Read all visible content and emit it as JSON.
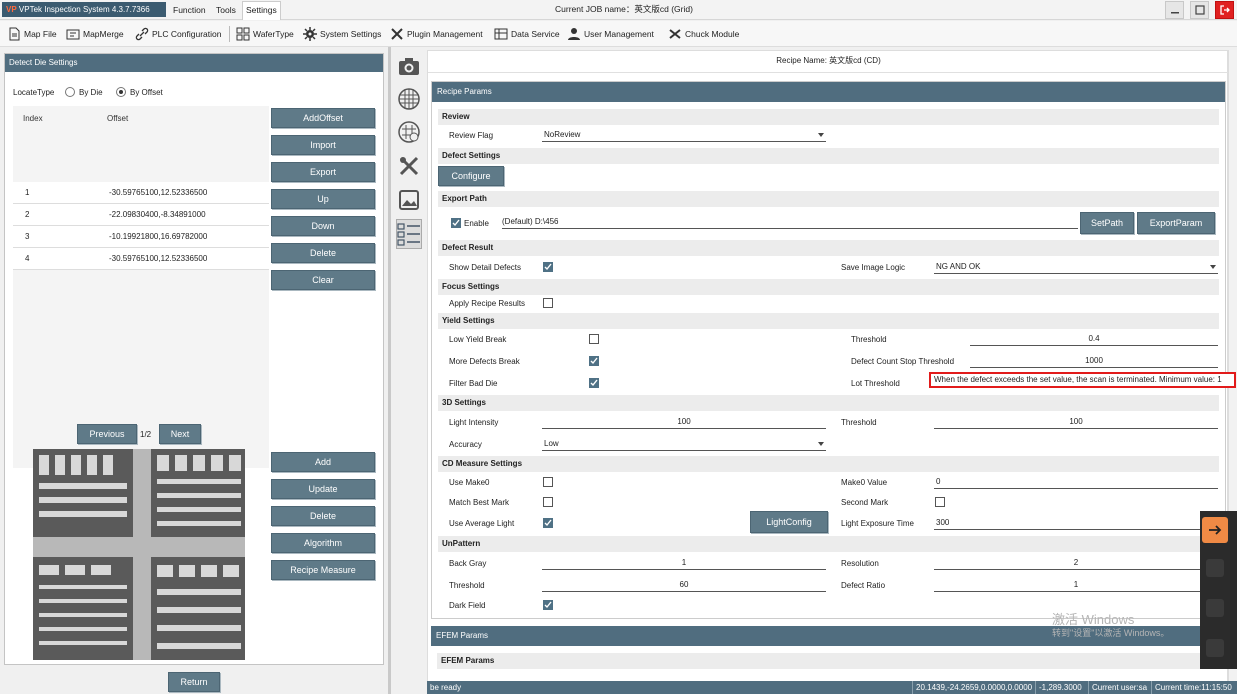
{
  "titlebar": {
    "app_name": "VPTek Inspection System 4.3.7.7366",
    "menus": [
      "Function",
      "Tools",
      "Settings"
    ],
    "job_name": "Current JOB name：英文版cd (Grid)"
  },
  "toolbar": {
    "items": [
      "Map File",
      "MapMerge",
      "PLC Configuration",
      "WaferType",
      "System Settings",
      "Plugin Management",
      "Data Service",
      "User Management",
      "Chuck Module"
    ]
  },
  "left_panel": {
    "title": "Detect Die Settings",
    "locate_type_label": "LocateType",
    "radio_by_die": "By Die",
    "radio_by_offset": "By Offset",
    "table_headers": [
      "Index",
      "Offset"
    ],
    "rows": [
      {
        "index": "1",
        "offset": "-30.59765100,12.52336500"
      },
      {
        "index": "2",
        "offset": "-22.09830400,-8.34891000"
      },
      {
        "index": "3",
        "offset": "-10.19921800,16.69782000"
      },
      {
        "index": "4",
        "offset": "-30.59765100,12.52336500"
      }
    ],
    "buttons_top": [
      "AddOffset",
      "Import",
      "Export",
      "Up",
      "Down",
      "Delete",
      "Clear"
    ],
    "prev_label": "Previous",
    "page": "1/2",
    "next_label": "Next",
    "buttons_bottom": [
      "Add",
      "Update",
      "Delete",
      "Algorithm",
      "Recipe Measure"
    ],
    "return_label": "Return"
  },
  "rail_icons": [
    "camera-icon",
    "wafer-grid-icon",
    "wafer-target-icon",
    "tools-icon",
    "image-icon",
    "checklist-icon"
  ],
  "main": {
    "recipe_name": "Recipe Name: 英文版cd (CD)",
    "recipe_params_title": "Recipe Params",
    "review": {
      "title": "Review",
      "flag_label": "Review Flag",
      "flag_value": "NoReview"
    },
    "defect_settings": {
      "title": "Defect Settings",
      "configure": "Configure"
    },
    "export_path": {
      "title": "Export Path",
      "enable": "Enable",
      "path": "(Default) D:\\456",
      "setpath": "SetPath",
      "exportparam": "ExportParam"
    },
    "defect_result": {
      "title": "Defect Result",
      "show_detail": "Show Detail Defects",
      "save_image_logic": "Save Image Logic",
      "save_image_value": "NG AND OK"
    },
    "focus_settings": {
      "title": "Focus Settings",
      "apply_recipe": "Apply Recipe Results"
    },
    "yield_settings": {
      "title": "Yield Settings",
      "low_yield": "Low Yield Break",
      "threshold_label": "Threshold",
      "threshold_value": "0.4",
      "more_defects": "More Defects Break",
      "defect_stop_label": "Defect Count Stop Threshold",
      "defect_stop_value": "1000",
      "filter_bad": "Filter Bad Die",
      "lot_threshold": "Lot Threshold",
      "tooltip": "When the defect exceeds the set value, the scan is terminated. Minimum value: 1"
    },
    "settings_3d": {
      "title": "3D Settings",
      "light_intensity": "Light Intensity",
      "light_intensity_value": "100",
      "threshold_label": "Threshold",
      "threshold_value": "100",
      "accuracy": "Accuracy",
      "accuracy_value": "Low"
    },
    "cd_measure": {
      "title": "CD Measure Settings",
      "use_make0": "Use Make0",
      "make0_value_label": "Make0 Value",
      "make0_value": "0",
      "match_best": "Match Best Mark",
      "second_mark": "Second Mark",
      "use_avg_light": "Use Average Light",
      "lightconfig": "LightConfig",
      "light_exposure": "Light Exposure Time",
      "light_exposure_value": "300"
    },
    "unpattern": {
      "title": "UnPattern",
      "back_gray": "Back Gray",
      "back_gray_value": "1",
      "resolution": "Resolution",
      "resolution_value": "2",
      "threshold": "Threshold",
      "threshold_value": "60",
      "defect_ratio": "Defect Ratio",
      "defect_ratio_value": "1",
      "dark_field": "Dark Field"
    },
    "efem_params_title": "EFEM Params",
    "efem_params_sub": "EFEM Params"
  },
  "statusbar": {
    "status": "be ready",
    "coords": "20.1439,-24.2659,0.0000,0.0000",
    "z": "-1,289.3000",
    "user": "Current user:sa",
    "time": "Current time:11:15:50"
  },
  "watermark": {
    "line1": "激活 Windows",
    "line2": "转到\"设置\"以激活 Windows。"
  },
  "colors": {
    "header": "#506d7f",
    "button": "#5f7a88",
    "close": "#e02020",
    "tooltip_border": "#e21b1b"
  }
}
